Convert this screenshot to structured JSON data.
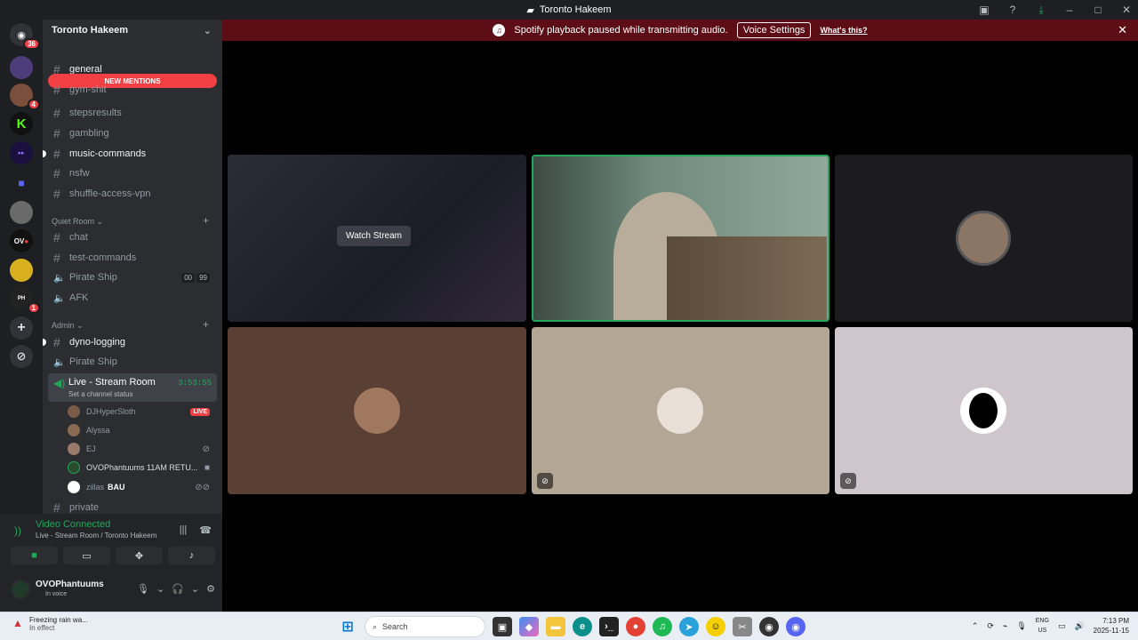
{
  "window": {
    "title": "Toronto Hakeem"
  },
  "banner": {
    "message": "Spotify playback paused while transmitting audio.",
    "button": "Voice Settings",
    "link": "What's this?"
  },
  "servers": [
    {
      "name": "home",
      "badge": "36"
    },
    {
      "name": "server-2",
      "badge": ""
    },
    {
      "name": "server-3",
      "badge": "4"
    },
    {
      "name": "server-4",
      "badge": ""
    },
    {
      "name": "server-5",
      "badge": ""
    },
    {
      "name": "server-6",
      "badge": ""
    },
    {
      "name": "server-7",
      "badge": ""
    },
    {
      "name": "server-8",
      "badge": ""
    },
    {
      "name": "server-9",
      "badge": ""
    },
    {
      "name": "server-10",
      "badge": "1"
    }
  ],
  "guild": {
    "name": "Toronto Hakeem",
    "new_mentions": "NEW MENTIONS"
  },
  "channels": [
    {
      "name": "general",
      "type": "text",
      "unread": true
    },
    {
      "name": "gym-shit",
      "type": "text",
      "unread": false
    },
    {
      "name": "stepsresults",
      "type": "text",
      "unread": false
    },
    {
      "name": "gambling",
      "type": "text",
      "unread": false
    },
    {
      "name": "music-commands",
      "type": "text",
      "unread": true
    },
    {
      "name": "nsfw",
      "type": "text",
      "unread": false
    },
    {
      "name": "shuffle-access-vpn",
      "type": "text",
      "unread": false
    }
  ],
  "quiet_room": {
    "label": "Quiet Room",
    "channels": [
      {
        "name": "chat",
        "type": "text"
      },
      {
        "name": "test-commands",
        "type": "text"
      },
      {
        "name": "Pirate Ship",
        "type": "voice",
        "count_a": "00",
        "count_b": "99"
      },
      {
        "name": "AFK",
        "type": "voice"
      }
    ]
  },
  "admin": {
    "label": "Admin",
    "channels": [
      {
        "name": "dyno-logging",
        "type": "text",
        "unread": true
      },
      {
        "name": "Pirate Ship",
        "type": "voice"
      }
    ]
  },
  "active_channel": {
    "name": "Live - Stream Room",
    "status": "Set a channel status",
    "timer": "3:53:55"
  },
  "voice_users": [
    {
      "name": "DJHyperSloth",
      "tag": "LIVE",
      "color": "#7a5a48"
    },
    {
      "name": "Alyssa",
      "tag": "",
      "color": "#8a6a52"
    },
    {
      "name": "EJ",
      "tag": "",
      "color": "#9a7a6a"
    },
    {
      "name": "OVOPhantuums 11AM RETU...",
      "tag": "",
      "color": "#2a4a30"
    },
    {
      "name": "zillas",
      "tag": "BAU",
      "color": "#ffffff"
    }
  ],
  "partial_channel": "private",
  "voice_panel": {
    "status": "Video Connected",
    "location": "Live - Stream Room / Toronto Hakeem"
  },
  "user": {
    "name": "OVOPhantuums",
    "status": "In voice"
  },
  "stream": {
    "watch_label": "Watch Stream"
  },
  "tiles": [
    {
      "name": "stream-tile",
      "bg": "#20232b"
    },
    {
      "name": "camera-tile",
      "bg": "#5f7b6c"
    },
    {
      "name": "avatar-tile",
      "bg": "#1c1c1e"
    },
    {
      "name": "brown-tile",
      "bg": "#5a4034"
    },
    {
      "name": "tan-tile",
      "bg": "#b3a695"
    },
    {
      "name": "lavender-tile",
      "bg": "#cfc6cb"
    }
  ],
  "taskbar": {
    "weather_title": "Freezing rain wa...",
    "weather_sub": "In effect",
    "search_placeholder": "Search",
    "lang": "ENG",
    "region": "US",
    "time": "7:13 PM",
    "date": "2025-11-15"
  }
}
